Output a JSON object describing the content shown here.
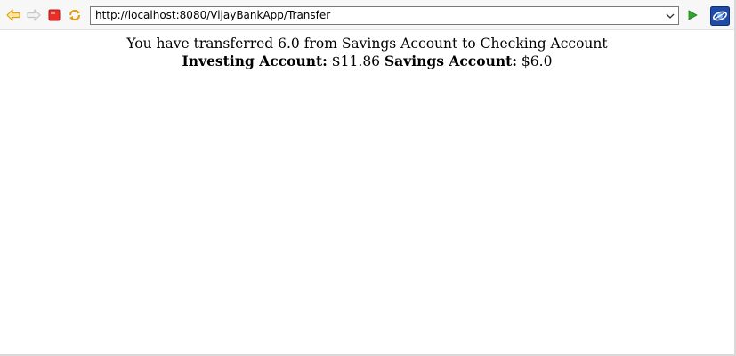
{
  "toolbar": {
    "url": "http://localhost:8080/VijayBankApp/Transfer",
    "icons": {
      "back": "back-arrow-icon",
      "forward": "forward-arrow-icon",
      "stop": "stop-icon",
      "refresh": "refresh-icon",
      "dropdown": "chevron-down-icon",
      "go": "go-play-icon",
      "browser": "browser-logo-icon"
    },
    "colors": {
      "back_arrow": "#e8a317",
      "stop": "#e02020",
      "go": "#2fa82f",
      "browser_logo": "#1e4aa8"
    }
  },
  "page": {
    "message": "You have transferred 6.0 from Savings Account to Checking Account",
    "balances": {
      "investing_label": "Investing Account:",
      "investing_value": " $11.86 ",
      "savings_label": "Savings Account:",
      "savings_value": " $6.0"
    }
  }
}
